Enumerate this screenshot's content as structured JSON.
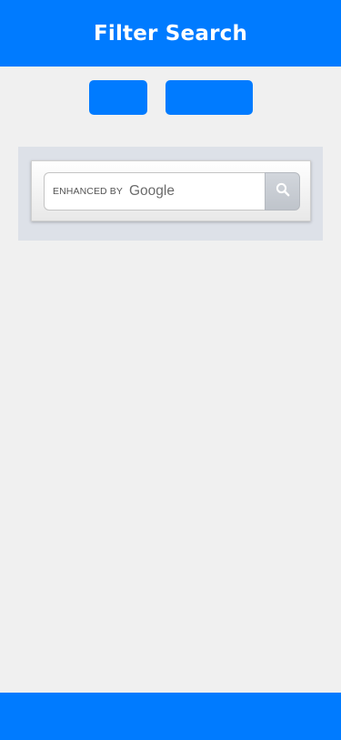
{
  "header": {
    "title": "Filter Search"
  },
  "buttons": [
    {
      "label": ""
    },
    {
      "label": ""
    }
  ],
  "search": {
    "enhanced_by": "ENHANCED BY",
    "brand": "Google",
    "value": "",
    "submit_icon": "search-icon"
  },
  "colors": {
    "brand_blue": "#007bff",
    "page_background": "#f0f0f0",
    "search_panel_background": "#dde1e8"
  }
}
